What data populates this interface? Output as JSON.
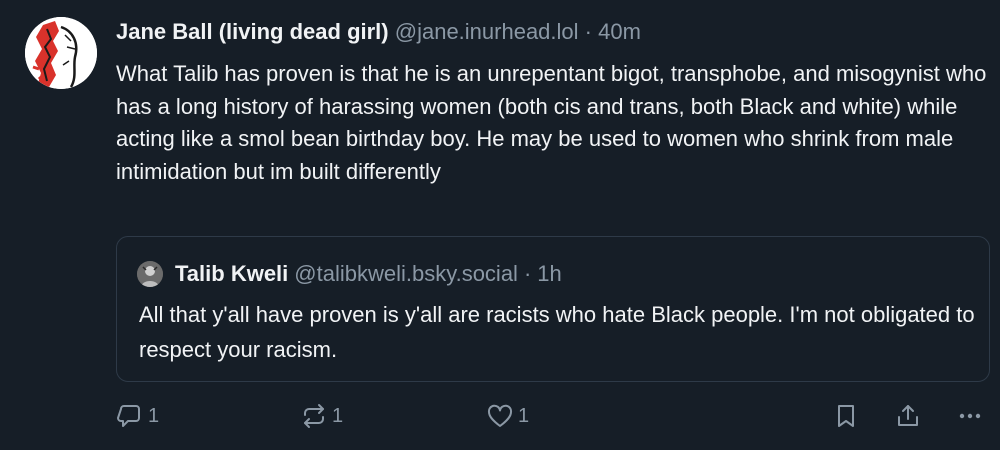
{
  "post": {
    "author_name": "Jane Ball (living dead girl)",
    "author_handle": "@jane.inurhead.lol",
    "separator": "·",
    "timestamp": "40m",
    "text": "What Talib has proven is that he is an unrepentant bigot, transphobe, and misogynist who has a long history of harassing women (both cis and trans, both Black and white) while acting like a smol bean birthday boy. He may be used to women who shrink from male intimidation but im built differently"
  },
  "quoted_post": {
    "author_name": "Talib Kweli",
    "author_handle": "@talibkweli.bsky.social",
    "separator": "·",
    "timestamp": "1h",
    "text": "All that y'all have proven is y'all are racists who hate Black people. I'm not obligated to respect your racism."
  },
  "actions": {
    "reply_count": "1",
    "repost_count": "1",
    "like_count": "1"
  },
  "icons": {
    "reply": "reply-icon",
    "repost": "repost-icon",
    "like": "heart-icon",
    "bookmark": "bookmark-icon",
    "share": "share-icon",
    "more": "more-icon"
  },
  "colors": {
    "background": "#161e27",
    "text": "#f1f3f5",
    "muted": "#8b98a5",
    "border": "#2e3a48",
    "avatar_accent": "#d9322b"
  }
}
